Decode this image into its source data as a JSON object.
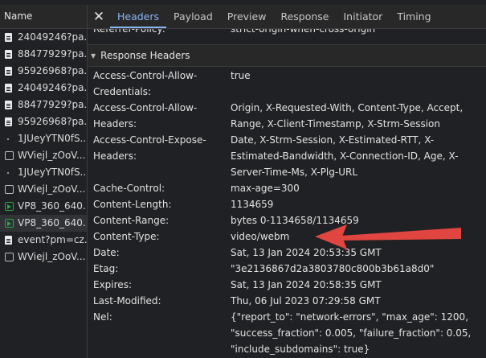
{
  "sidebar": {
    "header": "Name",
    "items": [
      {
        "label": "24049246?pa...",
        "icon": "document-icon"
      },
      {
        "label": "88477929?pa...",
        "icon": "document-icon"
      },
      {
        "label": "95926968?pa...",
        "icon": "document-icon"
      },
      {
        "label": "24049246?pa...",
        "icon": "document-icon"
      },
      {
        "label": "88477929?pa...",
        "icon": "document-icon"
      },
      {
        "label": "95926968?pa...",
        "icon": "document-icon"
      },
      {
        "label": "1JUeyYTN0fS...",
        "icon": "dot-icon"
      },
      {
        "label": "WViejl_zOoV...",
        "icon": "checkbox-icon"
      },
      {
        "label": "1JUeyYTN0fS...",
        "icon": "dot-icon"
      },
      {
        "label": "WViejl_zOoV...",
        "icon": "checkbox-icon"
      },
      {
        "label": "VP8_360_640...",
        "icon": "media-icon"
      },
      {
        "label": "VP8_360_640...",
        "icon": "media-icon"
      },
      {
        "label": "event?pm=cz...",
        "icon": "document-icon"
      },
      {
        "label": "WViejl_zOoV...",
        "icon": "checkbox-icon"
      }
    ]
  },
  "tabs": {
    "close": "✕",
    "items": [
      "Headers",
      "Payload",
      "Preview",
      "Response",
      "Initiator",
      "Timing"
    ],
    "active": "Headers"
  },
  "partial_row": {
    "name": "Referrer-Policy:",
    "value": "strict-origin-when-cross-origin"
  },
  "section": {
    "toggle": "▼",
    "title": "Response Headers"
  },
  "headers": [
    {
      "name": "Access-Control-Allow-Credentials:",
      "value": "true"
    },
    {
      "name": "Access-Control-Allow-Headers:",
      "value": "Origin, X-Requested-With, Content-Type, Accept, Range, X-Client-Timestamp, X-Strm-Session"
    },
    {
      "name": "Access-Control-Expose-Headers:",
      "value": "Date, X-Strm-Session, X-Estimated-RTT, X-Estimated-Bandwidth, X-Connection-ID, Age, X-Server-Time-Ms, X-Plg-URL"
    },
    {
      "name": "Cache-Control:",
      "value": "max-age=300"
    },
    {
      "name": "Content-Length:",
      "value": "1134659"
    },
    {
      "name": "Content-Range:",
      "value": "bytes 0-1134658/1134659"
    },
    {
      "name": "Content-Type:",
      "value": "video/webm"
    },
    {
      "name": "Date:",
      "value": "Sat, 13 Jan 2024 20:53:35 GMT"
    },
    {
      "name": "Etag:",
      "value": "\"3e2136867d2a3803780c800b3b61a8d0\""
    },
    {
      "name": "Expires:",
      "value": "Sat, 13 Jan 2024 20:58:35 GMT"
    },
    {
      "name": "Last-Modified:",
      "value": "Thu, 06 Jul 2023 07:29:58 GMT"
    },
    {
      "name": "Nel:",
      "value": "{\"report_to\": \"network-errors\", \"max_age\": 1200, \"success_fraction\": 0.005, \"failure_fraction\": 0.05, \"include_subdomains\": true}"
    }
  ],
  "colors": {
    "accent": "#8ab4f8",
    "annotation_arrow": "#e0453f",
    "media_icon": "#28a745"
  }
}
